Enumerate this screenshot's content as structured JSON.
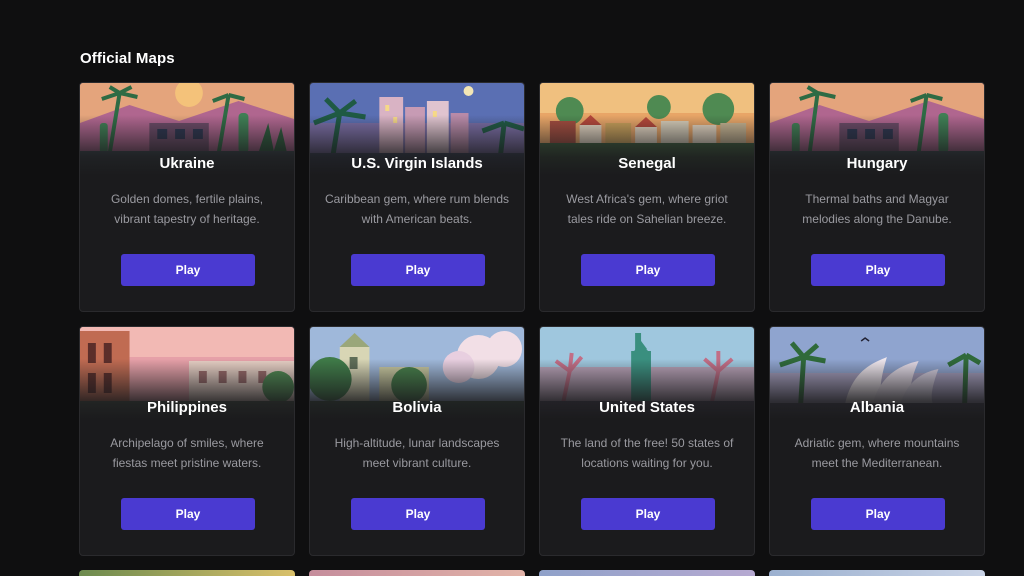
{
  "section_title": "Official Maps",
  "maps": [
    {
      "name": "Ukraine",
      "description": "Golden domes, fertile plains, vibrant tapestry of heritage.",
      "play_label": "Play",
      "art": "desert-palms-house"
    },
    {
      "name": "U.S. Virgin Islands",
      "description": "Caribbean gem, where rum blends with American beats.",
      "play_label": "Play",
      "art": "night-city-palms"
    },
    {
      "name": "Senegal",
      "description": "West Africa's gem, where griot tales ride on Sahelian breeze.",
      "play_label": "Play",
      "art": "village-houses-sunset"
    },
    {
      "name": "Hungary",
      "description": "Thermal baths and Magyar melodies along the Danube.",
      "play_label": "Play",
      "art": "desert-palms-house"
    },
    {
      "name": "Philippines",
      "description": "Archipelago of smiles, where fiestas meet pristine waters.",
      "play_label": "Play",
      "art": "pink-sky-buildings"
    },
    {
      "name": "Bolivia",
      "description": "High-altitude, lunar landscapes meet vibrant culture.",
      "play_label": "Play",
      "art": "clouds-church-trees"
    },
    {
      "name": "United States",
      "description": "The land of the free! 50 states of locations waiting for you.",
      "play_label": "Play",
      "art": "statue-of-liberty"
    },
    {
      "name": "Albania",
      "description": "Adriatic gem, where mountains meet the Mediterranean.",
      "play_label": "Play",
      "art": "opera-house-palms"
    }
  ],
  "colors": {
    "background": "#0f0f10",
    "card": "#1b1b1d",
    "play_button": "#4a3ad1",
    "description_text": "#9a9aa0"
  }
}
